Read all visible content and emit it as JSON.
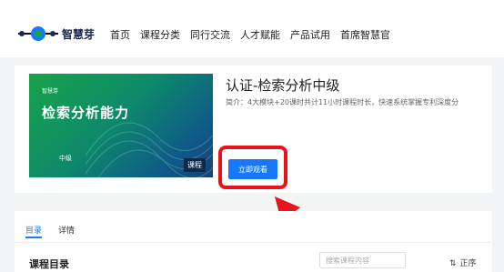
{
  "brand": {
    "name": "智慧芽"
  },
  "nav": {
    "items": [
      {
        "label": "首页"
      },
      {
        "label": "课程分类"
      },
      {
        "label": "同行交流"
      },
      {
        "label": "人才赋能"
      },
      {
        "label": "产品试用"
      },
      {
        "label": "首席智慧官"
      }
    ]
  },
  "course": {
    "thumbnail": {
      "brand": "智慧芽",
      "title": "检索分析能力",
      "level": "中级",
      "badge": "课程"
    },
    "title": "认证-检索分析中级",
    "description": "简介：4大模块+20课时共计11小时课程时长，快速系统掌握专利深度分",
    "watch_button": "立即观看"
  },
  "tabs": {
    "items": [
      {
        "label": "目录"
      },
      {
        "label": "详情"
      }
    ],
    "active_index": 0
  },
  "catalog": {
    "title": "课程目录",
    "search_placeholder": "搜索课程内容",
    "sort_label": "正序"
  },
  "colors": {
    "accent": "#1677ff",
    "highlight": "#e8141c"
  }
}
